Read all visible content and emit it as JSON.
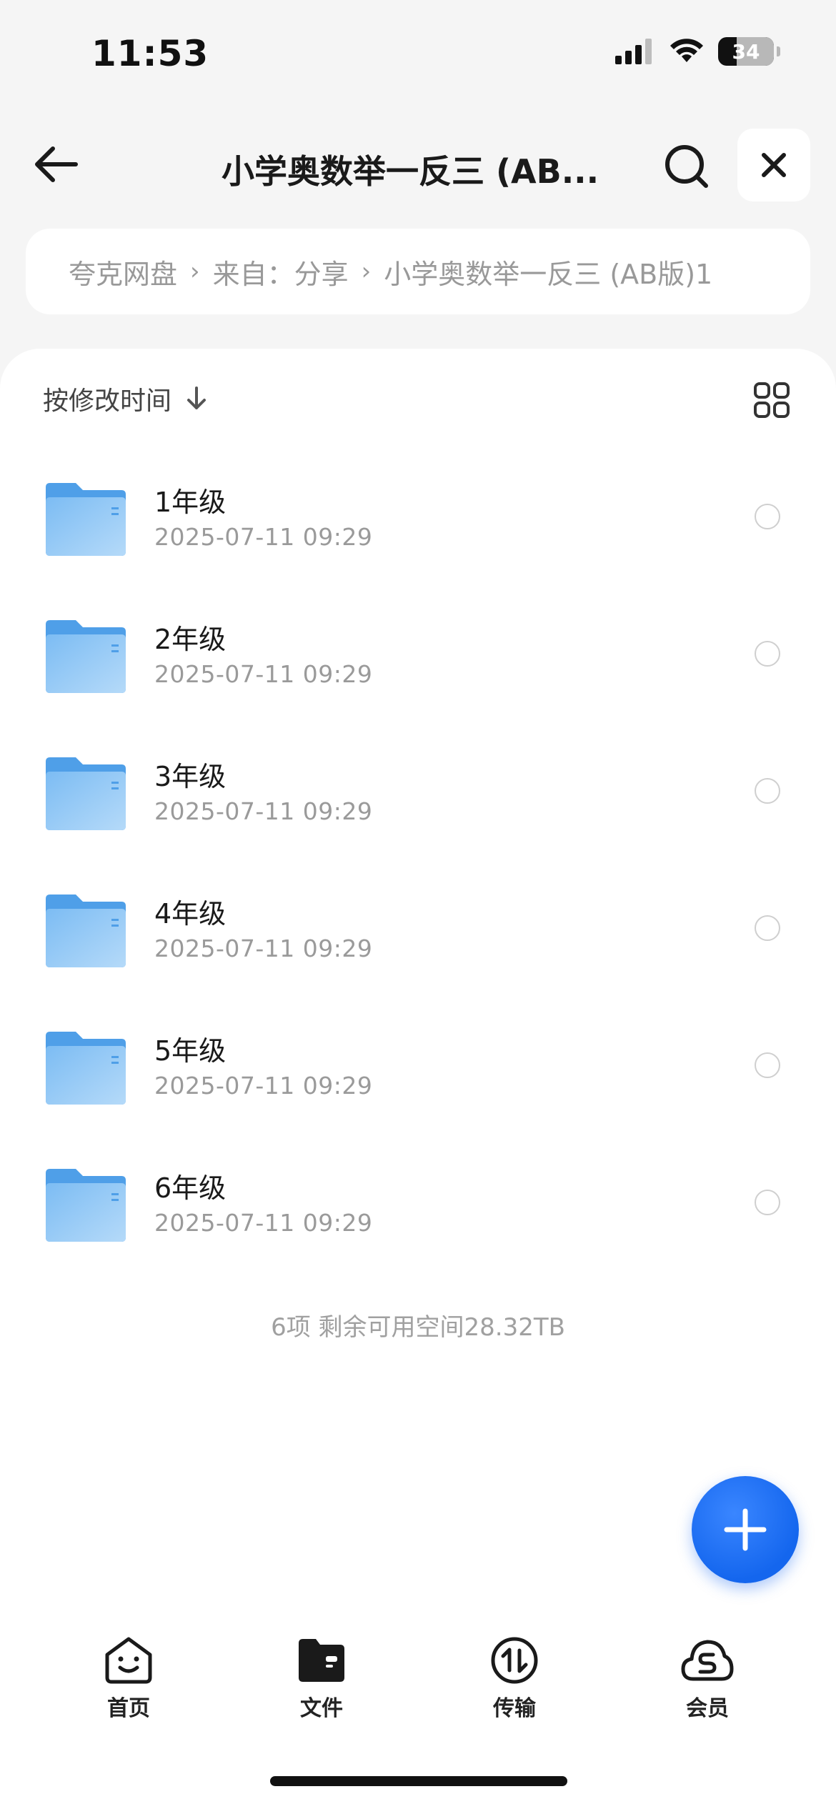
{
  "status_bar": {
    "time": "11:53",
    "battery": "34"
  },
  "nav": {
    "title": "小学奥数举一反三 (AB..."
  },
  "breadcrumb": {
    "items": [
      "夸克网盘",
      "来自：分享",
      "小学奥数举一反三 (AB版)1"
    ],
    "separator": "›"
  },
  "sort": {
    "label": "按修改时间"
  },
  "files": [
    {
      "name": "1年级",
      "date": "2025-07-11 09:29"
    },
    {
      "name": "2年级",
      "date": "2025-07-11 09:29"
    },
    {
      "name": "3年级",
      "date": "2025-07-11 09:29"
    },
    {
      "name": "4年级",
      "date": "2025-07-11 09:29"
    },
    {
      "name": "5年级",
      "date": "2025-07-11 09:29"
    },
    {
      "name": "6年级",
      "date": "2025-07-11 09:29"
    }
  ],
  "summary": "6项 剩余可用空间28.32TB",
  "tabs": [
    {
      "label": "首页",
      "icon": "home-face-icon"
    },
    {
      "label": "文件",
      "icon": "folder-icon"
    },
    {
      "label": "传输",
      "icon": "transfer-icon"
    },
    {
      "label": "会员",
      "icon": "cloud-member-icon"
    }
  ],
  "colors": {
    "accent": "#1466ee",
    "folder": "#5aa6ee"
  }
}
